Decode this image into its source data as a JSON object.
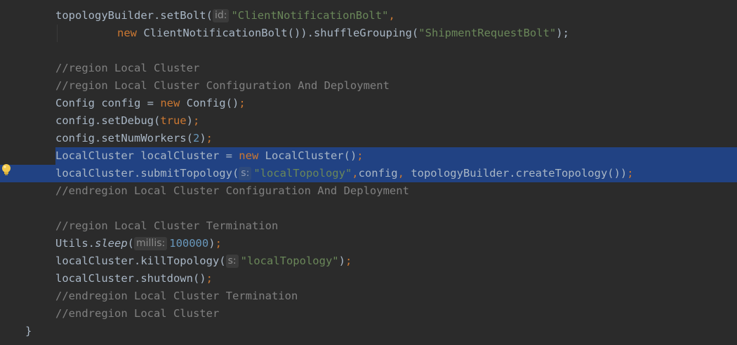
{
  "editor": {
    "lines": [
      {
        "id": "l1",
        "segments": [
          {
            "t": "topologyBuilder.setBolt(",
            "c": "plain"
          },
          {
            "t": "id:",
            "c": "hint"
          },
          {
            "t": "\"ClientNotificationBolt\"",
            "c": "str"
          },
          {
            "t": ",",
            "c": "kw"
          }
        ]
      },
      {
        "id": "l2",
        "segments": [
          {
            "t": "new",
            "c": "kw"
          },
          {
            "t": " ClientNotificationBolt()).shuffleGrouping(",
            "c": "plain"
          },
          {
            "t": "\"ShipmentRequestBolt\"",
            "c": "str"
          },
          {
            "t": ");",
            "c": "plain"
          }
        ]
      },
      {
        "id": "l3",
        "segments": []
      },
      {
        "id": "l4",
        "segments": [
          {
            "t": "//region Local Cluster",
            "c": "cmt"
          }
        ]
      },
      {
        "id": "l5",
        "segments": [
          {
            "t": "//region Local Cluster Configuration And Deployment",
            "c": "cmt"
          }
        ]
      },
      {
        "id": "l6",
        "segments": [
          {
            "t": "Config config = ",
            "c": "plain"
          },
          {
            "t": "new",
            "c": "kw"
          },
          {
            "t": " Config()",
            "c": "plain"
          },
          {
            "t": ";",
            "c": "kw"
          }
        ]
      },
      {
        "id": "l7",
        "segments": [
          {
            "t": "config.setDebug(",
            "c": "plain"
          },
          {
            "t": "true",
            "c": "kw"
          },
          {
            "t": ")",
            "c": "plain"
          },
          {
            "t": ";",
            "c": "kw"
          }
        ]
      },
      {
        "id": "l8",
        "segments": [
          {
            "t": "config.setNumWorkers(",
            "c": "plain"
          },
          {
            "t": "2",
            "c": "num"
          },
          {
            "t": ")",
            "c": "plain"
          },
          {
            "t": ";",
            "c": "kw"
          }
        ]
      },
      {
        "id": "l9",
        "selected": true,
        "segments": [
          {
            "t": "LocalCluster localCluster = ",
            "c": "plain"
          },
          {
            "t": "new",
            "c": "kw"
          },
          {
            "t": " LocalCluster()",
            "c": "plain"
          },
          {
            "t": ";",
            "c": "kw"
          }
        ]
      },
      {
        "id": "l10",
        "selected": true,
        "segments": [
          {
            "t": "localCluster.submitTopology(",
            "c": "plain"
          },
          {
            "t": "s:",
            "c": "hint"
          },
          {
            "t": "\"localTopology\"",
            "c": "str"
          },
          {
            "t": ",",
            "c": "kw"
          },
          {
            "t": "config",
            "c": "plain"
          },
          {
            "t": ",",
            "c": "kw"
          },
          {
            "t": " topologyBuilder.createTopology())",
            "c": "plain"
          },
          {
            "t": ";",
            "c": "kw"
          }
        ]
      },
      {
        "id": "l11",
        "segments": [
          {
            "t": "//endregion Local Cluster Configuration And Deployment",
            "c": "cmt"
          }
        ]
      },
      {
        "id": "l12",
        "segments": []
      },
      {
        "id": "l13",
        "segments": [
          {
            "t": "//region Local Cluster Termination",
            "c": "cmt"
          }
        ]
      },
      {
        "id": "l14",
        "segments": [
          {
            "t": "Utils.",
            "c": "plain"
          },
          {
            "t": "sleep",
            "c": "italic"
          },
          {
            "t": "(",
            "c": "plain"
          },
          {
            "t": "millis:",
            "c": "hint"
          },
          {
            "t": "100000",
            "c": "num"
          },
          {
            "t": ")",
            "c": "plain"
          },
          {
            "t": ";",
            "c": "kw"
          }
        ]
      },
      {
        "id": "l15",
        "segments": [
          {
            "t": "localCluster.killTopology(",
            "c": "plain"
          },
          {
            "t": "s:",
            "c": "hint"
          },
          {
            "t": "\"localTopology\"",
            "c": "str"
          },
          {
            "t": ")",
            "c": "plain"
          },
          {
            "t": ";",
            "c": "kw"
          }
        ]
      },
      {
        "id": "l16",
        "segments": [
          {
            "t": "localCluster.shutdown()",
            "c": "plain"
          },
          {
            "t": ";",
            "c": "kw"
          }
        ]
      },
      {
        "id": "l17",
        "segments": [
          {
            "t": "//endregion Local Cluster Termination",
            "c": "cmt"
          }
        ]
      },
      {
        "id": "l18",
        "segments": [
          {
            "t": "//endregion Local Cluster",
            "c": "cmt"
          }
        ]
      }
    ],
    "closing_brace": "}"
  },
  "icons": {
    "intention": "lightbulb-icon"
  },
  "colors": {
    "background": "#2b2b2b",
    "selection": "#214283",
    "keyword": "#cc7832",
    "string": "#6a8759",
    "number": "#6897bb",
    "comment": "#808080",
    "text": "#a9b7c6"
  }
}
